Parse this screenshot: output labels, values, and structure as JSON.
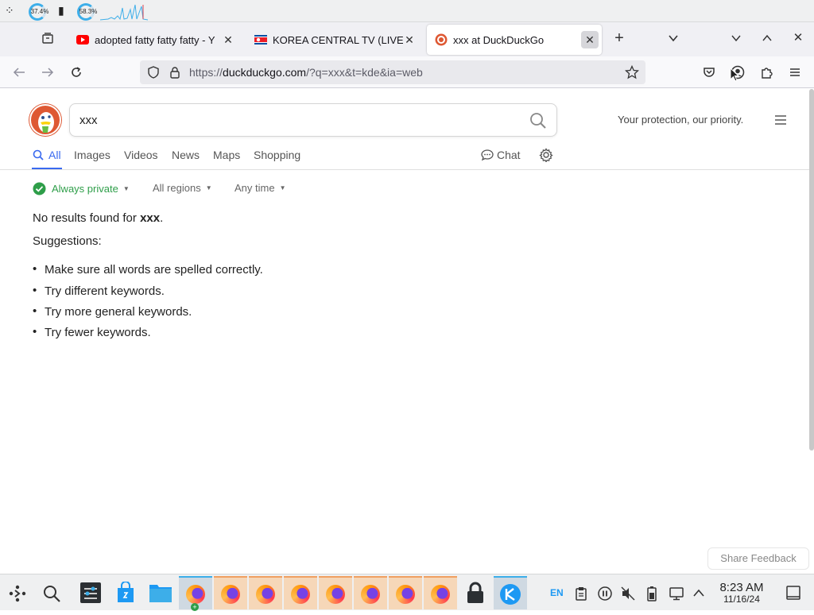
{
  "system_bar": {
    "cpu_percent": "37.4%",
    "mem_percent": "58.3%"
  },
  "tabs": [
    {
      "title": "adopted fatty fatty fatty - Y",
      "active": false
    },
    {
      "title": "KOREA CENTRAL TV (LIVES",
      "active": false
    },
    {
      "title": "xxx at DuckDuckGo",
      "active": true
    }
  ],
  "browser": {
    "url_scheme": "https://",
    "url_host": "duckduckgo.com",
    "url_rest": "/?q=xxx&t=kde&ia=web"
  },
  "page": {
    "search_query": "xxx",
    "tagline": "Your protection, our priority.",
    "nav_tabs": [
      {
        "label": "All",
        "active": true
      },
      {
        "label": "Images"
      },
      {
        "label": "Videos"
      },
      {
        "label": "News"
      },
      {
        "label": "Maps"
      },
      {
        "label": "Shopping"
      }
    ],
    "chat_label": "Chat",
    "filters": {
      "privacy": "Always private",
      "region": "All regions",
      "time": "Any time"
    },
    "no_results_prefix": "No results found for ",
    "no_results_query": "xxx",
    "no_results_suffix": ".",
    "suggestions_heading": "Suggestions:",
    "suggestions": [
      "Make sure all words are spelled correctly.",
      "Try different keywords.",
      "Try more general keywords.",
      "Try fewer keywords."
    ],
    "feedback_label": "Share Feedback"
  },
  "taskbar": {
    "language": "EN",
    "time": "8:23 AM",
    "date": "11/16/24"
  },
  "colors": {
    "accent_blue": "#3969ef",
    "ddg_orange": "#de5833",
    "private_green": "#2e9e49"
  }
}
